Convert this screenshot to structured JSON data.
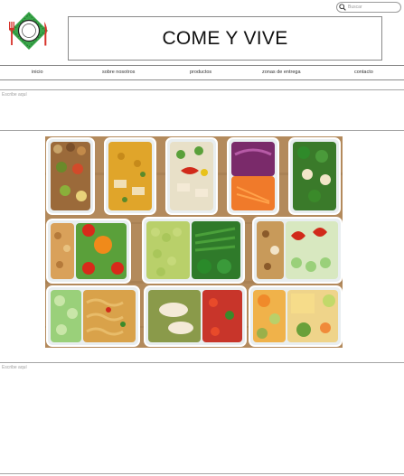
{
  "search": {
    "placeholder": "Buscar"
  },
  "header": {
    "title": "COME Y VIVE"
  },
  "nav": {
    "items": [
      {
        "label": "inicio"
      },
      {
        "label": "sobre nosotros"
      },
      {
        "label": "productos"
      },
      {
        "label": "zonas de entrega"
      },
      {
        "label": "contacto"
      }
    ]
  },
  "text_blocks": [
    {
      "placeholder": "Escribe aquí"
    },
    {
      "placeholder": "Escribe aquí"
    }
  ],
  "colors": {
    "logo_green": "#3aa64a",
    "logo_red": "#d7322b",
    "wood": "#b38a5c"
  },
  "icons": {
    "search": "magnifier-icon",
    "logo": "plate-cutlery-logo"
  }
}
